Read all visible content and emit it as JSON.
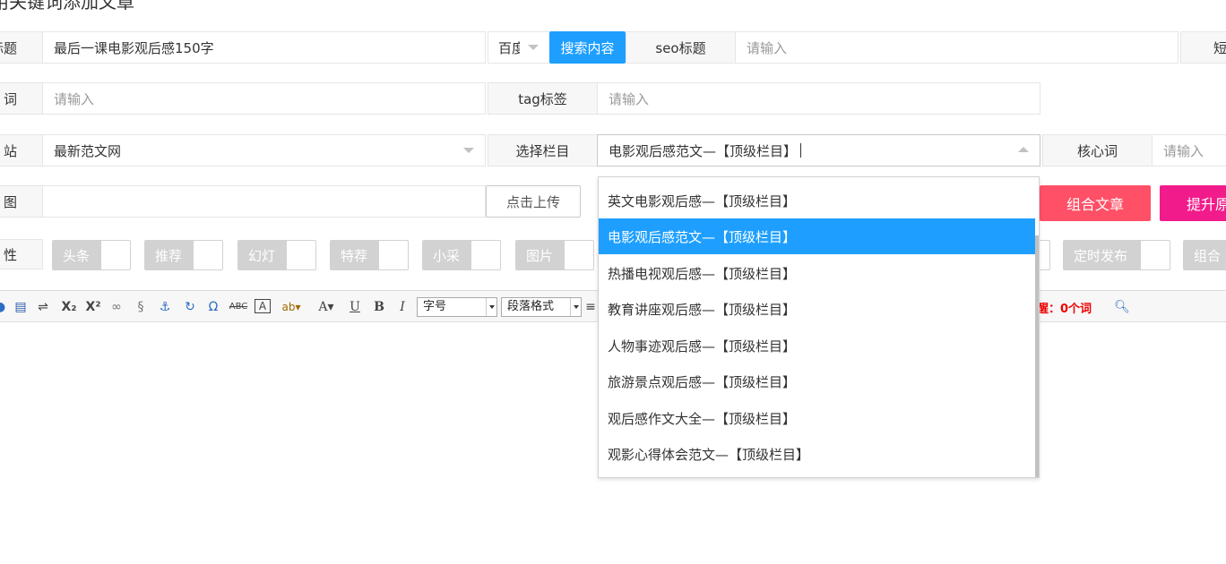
{
  "page": {
    "title": "用关键词添加文章"
  },
  "row1": {
    "title_label": "标题",
    "title_value": "最后一课电影观后感150字",
    "engine_select": "百度",
    "search_button": "搜索内容",
    "seo_label": "seo标题",
    "seo_placeholder": "请输入",
    "short_label": "短"
  },
  "row2": {
    "keyword_label": "词",
    "keyword_placeholder": "请输入",
    "tag_label": "tag标签",
    "tag_placeholder": "请输入"
  },
  "row3": {
    "site_label": "站",
    "site_value": "最新范文网",
    "column_label": "选择栏目",
    "column_value": "电影观后感范文—【顶级栏目】",
    "core_label": "核心词",
    "core_placeholder": "请输入"
  },
  "row4": {
    "image_label": "图",
    "upload_button": "点击上传",
    "combine_button": "组合文章",
    "improve_button": "提升原"
  },
  "row5": {
    "attr_label": "性",
    "switches": [
      "头条",
      "推荐",
      "幻灯",
      "特荐",
      "小采",
      "图片"
    ],
    "timed_publish": "定时发布",
    "combine_switch": "组合"
  },
  "toolbar": {
    "font_size": "字号",
    "paragraph_format": "段落格式",
    "word_reminder": "醒：0个词"
  },
  "column_dropdown": {
    "options": [
      "英文电影观后感—【顶级栏目】",
      "电影观后感范文—【顶级栏目】",
      "热播电视观后感—【顶级栏目】",
      "教育讲座观后感—【顶级栏目】",
      "人物事迹观后感—【顶级栏目】",
      "旅游景点观后感—【顶级栏目】",
      "观后感作文大全—【顶级栏目】",
      "观影心得体会范文—【顶级栏目】"
    ],
    "selected": "电影观后感范文—【顶级栏目】"
  },
  "colors": {
    "accent": "#1e9fff",
    "red": "#ff5067",
    "pink": "#f21b8b",
    "switch_off": "#d2d2d2"
  }
}
